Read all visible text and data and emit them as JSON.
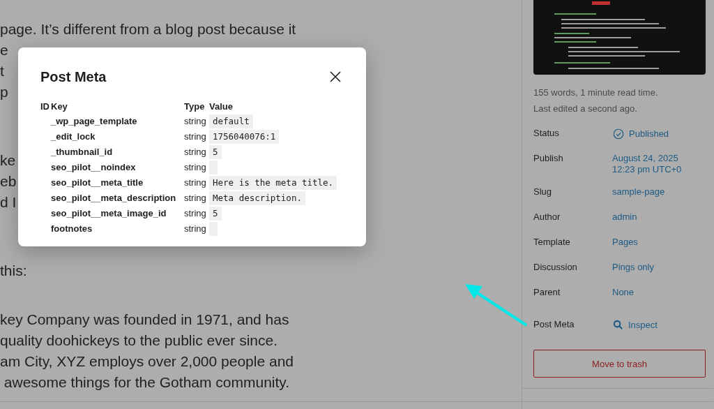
{
  "editor": {
    "paragraphs": [
      [
        "page. It’s different from a blog post because it",
        "e",
        "t",
        "p"
      ],
      [
        "ke",
        "eb",
        "d I"
      ],
      [
        "this:"
      ],
      [
        "key Company was founded in 1971, and has",
        "quality doohickeys to the public ever since.",
        "am City, XYZ employs over 2,000 people and",
        " awesome things for the Gotham community."
      ]
    ]
  },
  "modal": {
    "title": "Post Meta",
    "columns": [
      "ID",
      "Key",
      "Type",
      "Value"
    ],
    "rows": [
      {
        "key": "_wp_page_template",
        "type": "string",
        "value": "default"
      },
      {
        "key": "_edit_lock",
        "type": "string",
        "value": "1756040076:1"
      },
      {
        "key": "_thumbnail_id",
        "type": "string",
        "value": "5"
      },
      {
        "key": "seo_pilot__noindex",
        "type": "string"
      },
      {
        "key": "seo_pilot__meta_title",
        "type": "string",
        "value": "Here is the meta title."
      },
      {
        "key": "seo_pilot__meta_description",
        "type": "string",
        "value": "Meta description."
      },
      {
        "key": "seo_pilot__meta_image_id",
        "type": "string",
        "value": "5"
      },
      {
        "key": "footnotes",
        "type": "string"
      }
    ]
  },
  "sidebar": {
    "image": {
      "kind": "picture"
    },
    "stats": [
      "155 words, 1 minute read time.",
      "Last edited a second ago."
    ],
    "rows": [
      {
        "label": "Status",
        "kind": "status",
        "value": "Published"
      },
      {
        "label": "Publish",
        "kind": "link",
        "value": "August 24, 2025\n12:23 pm UTC+0"
      },
      {
        "label": "Slug",
        "kind": "link",
        "value": "sample-page"
      },
      {
        "label": "Author",
        "kind": "link",
        "value": "admin"
      },
      {
        "label": "Template",
        "kind": "link",
        "value": "Pages"
      },
      {
        "label": "Discussion",
        "kind": "link",
        "value": "Pings only"
      },
      {
        "label": "Parent",
        "kind": "link",
        "value": "None"
      },
      {
        "label": "Post Meta",
        "kind": "inspect",
        "value": "Inspect"
      }
    ],
    "trash_button": "Move to trash"
  }
}
